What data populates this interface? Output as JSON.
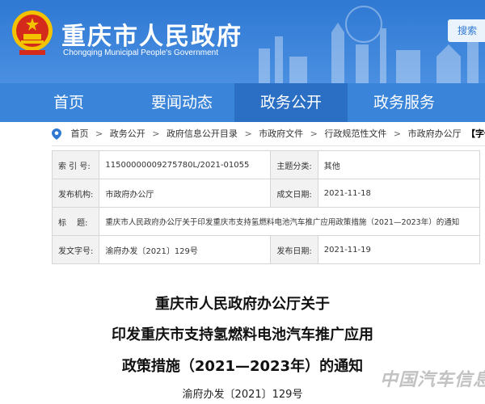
{
  "header": {
    "title": "重庆市人民政府",
    "subtitle": "Chongqing Municipal People's Government",
    "search_label": "搜索",
    "emblem_icon": "national-emblem-icon"
  },
  "nav": {
    "items": [
      {
        "label": "首页"
      },
      {
        "label": "要闻动态"
      },
      {
        "label": "政务公开"
      },
      {
        "label": "政务服务"
      }
    ],
    "active": "政务公开"
  },
  "breadcrumb": {
    "items": [
      "首页",
      "政务公开",
      "政府信息公开目录",
      "市政府文件",
      "行政规范性文件",
      "市政府办公厅"
    ],
    "separator": ">",
    "font_control": "【字体"
  },
  "info": {
    "index_label": "索 引 号:",
    "index_value": "11500000009275780L/2021-01055",
    "topic_label": "主题分类:",
    "topic_value": "其他",
    "issuer_label": "发布机构:",
    "issuer_value": "市政府办公厅",
    "date_label": "成文日期:",
    "date_value": "2021-11-18",
    "title_label": "标　 题:",
    "title_value": "重庆市人民政府办公厅关于印发重庆市支持氢燃料电池汽车推广应用政策措施（2021—2023年）的通知",
    "docno_label": "发文字号:",
    "docno_value": "渝府办发〔2021〕129号",
    "pub_label": "发布日期:",
    "pub_value": "2021-11-19"
  },
  "document": {
    "title_line1": "重庆市人民政府办公厅关于",
    "title_line2": "印发重庆市支持氢燃料电池汽车推广应用",
    "title_line3": "政策措施（2021—2023年）的通知",
    "number": "渝府办发〔2021〕129号"
  },
  "watermark": "中国汽车信息网",
  "colors": {
    "header_blue": "#2f79d3",
    "nav_blue": "#3a84d9",
    "nav_active": "#2b6fc4",
    "emblem_red": "#d42a1c",
    "emblem_gold": "#f3c300"
  }
}
